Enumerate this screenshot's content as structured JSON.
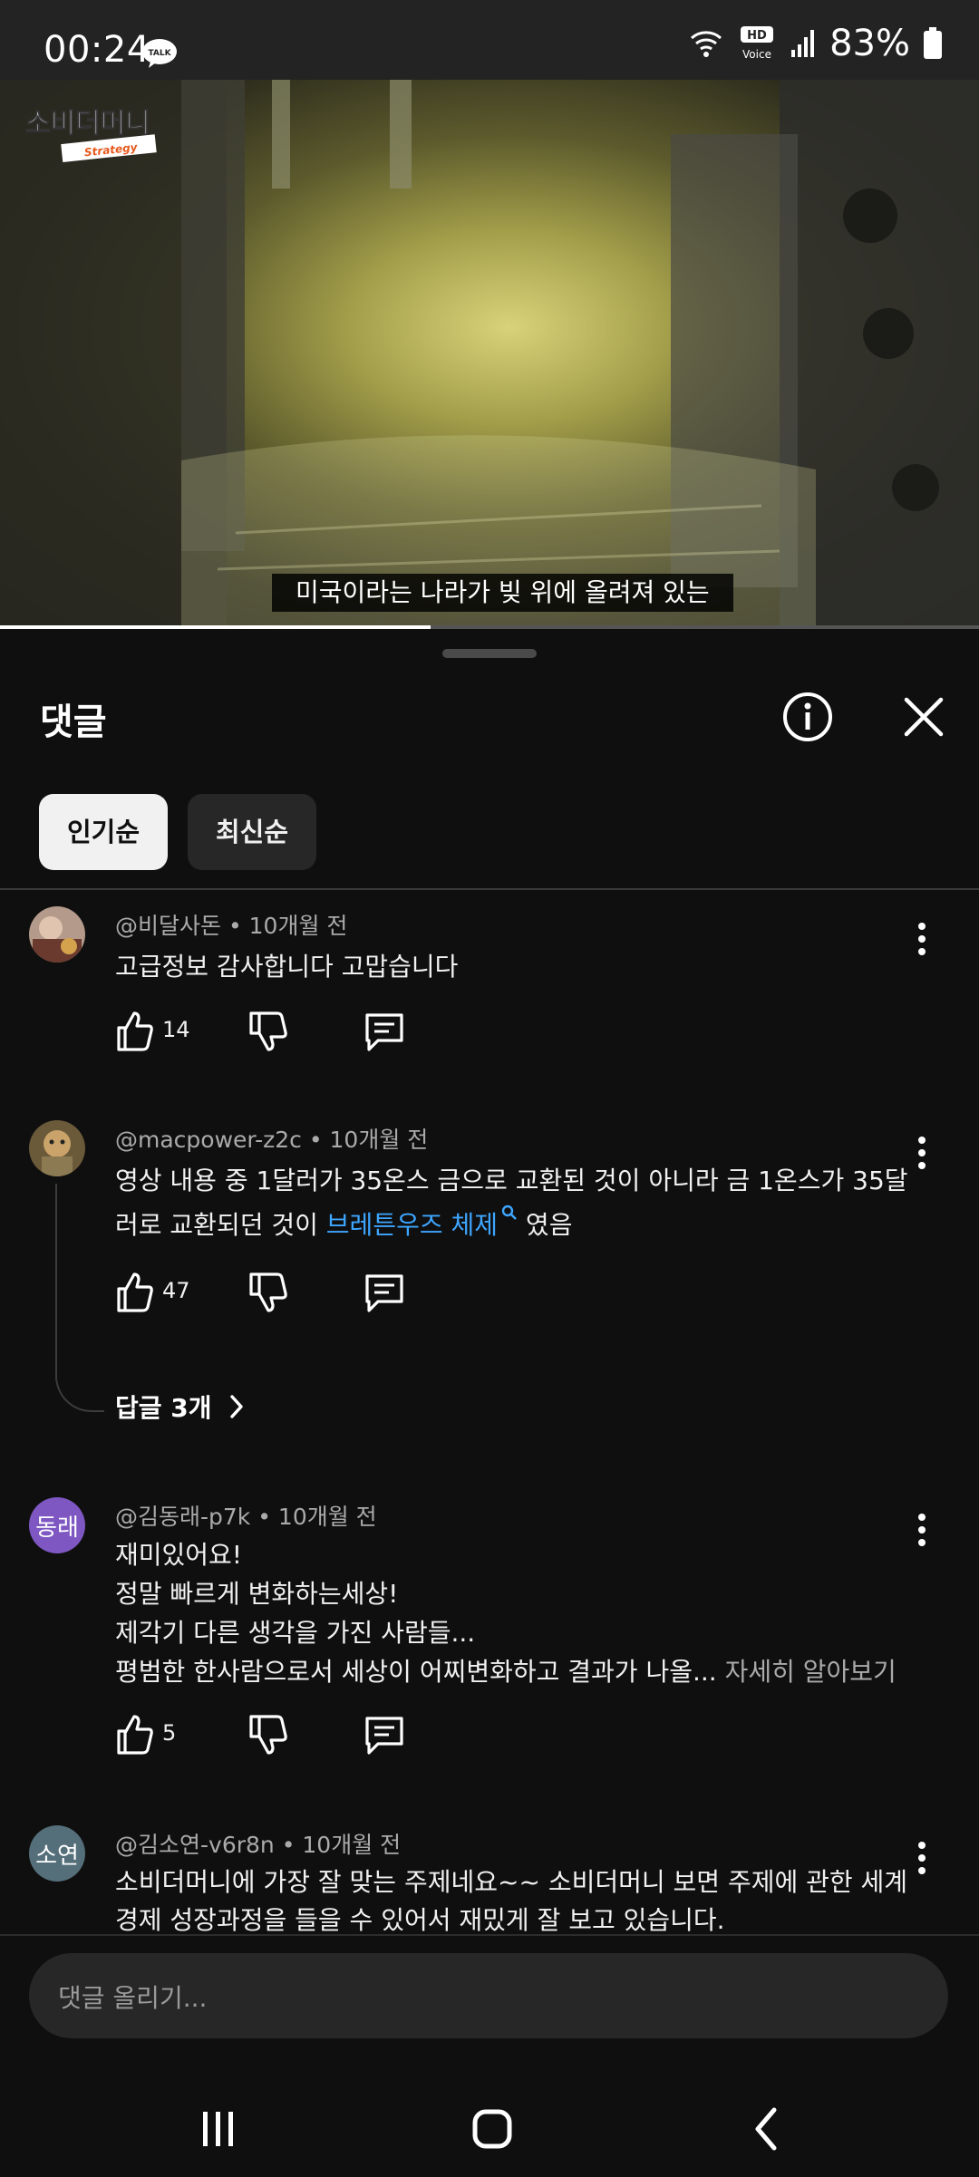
{
  "status_bar": {
    "time": "00:24",
    "talk_badge": "TALK",
    "hd_label": "HD",
    "voice_label": "Voice",
    "battery": "83%"
  },
  "video": {
    "brand_text": "소비더머니",
    "brand_sub": "Strategy",
    "subtitle": "미국이라는 나라가 빚 위에 올려져 있는",
    "progress": 0.44
  },
  "sheet": {
    "title": "댓글",
    "chips": [
      {
        "label": "인기순",
        "selected": true
      },
      {
        "label": "최신순",
        "selected": false
      }
    ]
  },
  "comments": [
    {
      "meta": "@비달사돈 • 10개월 전",
      "text": "고급정보 감사합니다 고맙습니다",
      "likes": "14",
      "avatar_type": "photo"
    },
    {
      "meta": "@macpower-z2c • 10개월 전",
      "text_before": "영상 내용 중 1달러가 35온스 금으로 교환된 것이 아니라 금 1온스가 35달러로 교환되던 것이 ",
      "link": "브레튼우즈 체제",
      "text_after": " 였음",
      "likes": "47",
      "replies": "답글 3개",
      "avatar_type": "photo"
    },
    {
      "meta": "@김동래-p7k • 10개월 전",
      "lines": [
        "재미있어요!",
        "정말 빠르게 변화하는세상!",
        "제각기 다른 생각을 가진 사람들..."
      ],
      "last_line": "평범한 한사람으로서 세상이 어찌변화하고 결과가 나올... ",
      "more": "자세히 알아보기",
      "likes": "5",
      "avatar_letter": "동래",
      "avatar_color": "#7e57c2"
    },
    {
      "meta": "@김소연-v6r8n • 10개월 전",
      "text": "소비더머니에 가장 잘 맞는 주제네요~~   소비더머니 보면 주제에 관한 세계경제 성장과정을 들을 수 있어서 재밌게 잘 보고 있습니다.",
      "avatar_letter": "소연",
      "avatar_color": "#546e7a"
    }
  ],
  "input": {
    "placeholder": "댓글 올리기..."
  }
}
